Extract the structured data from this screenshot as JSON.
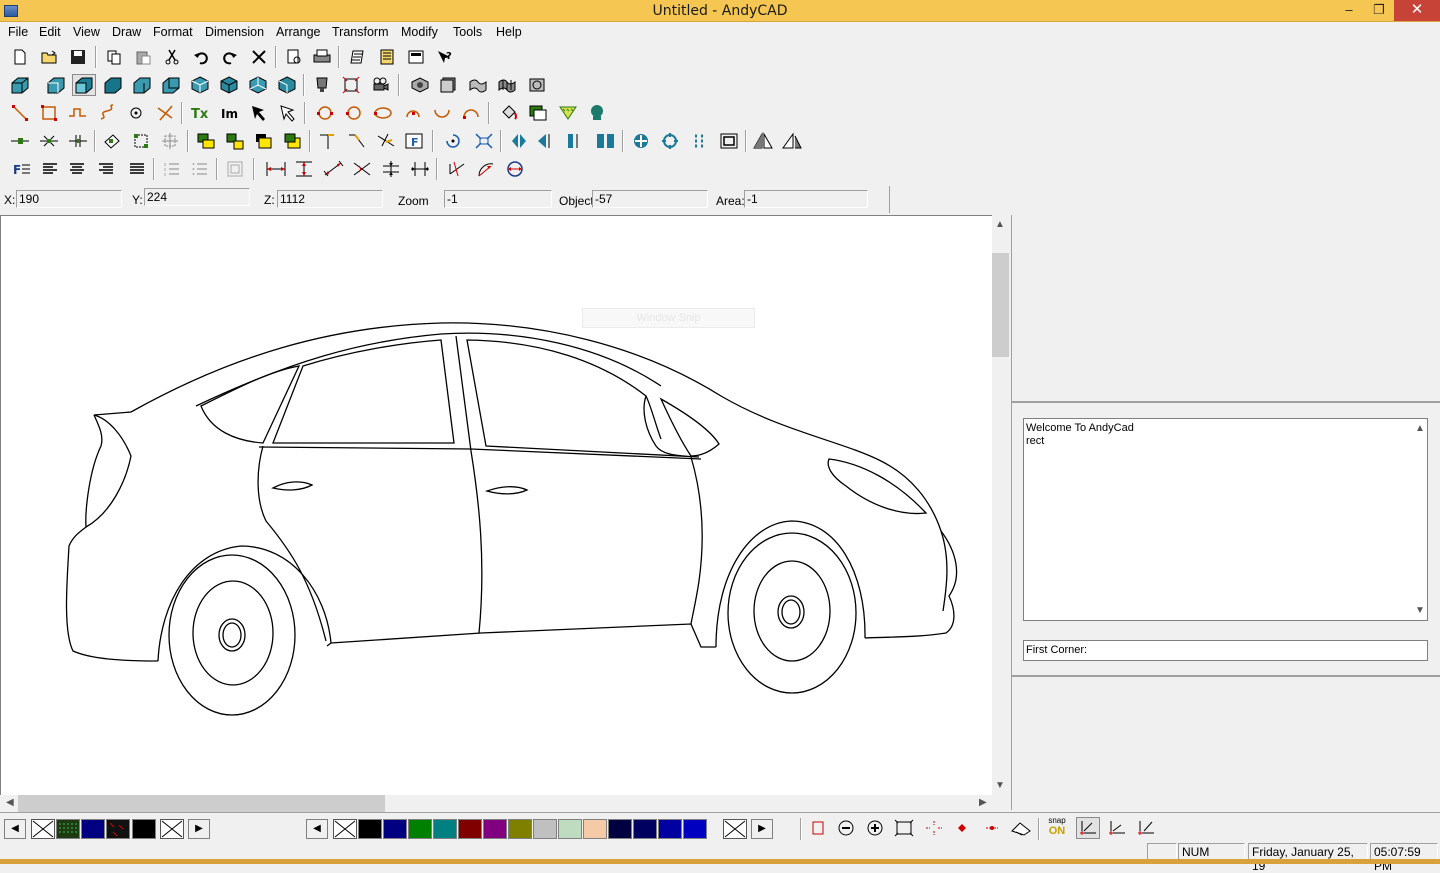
{
  "window": {
    "title": "Untitled - AndyCAD",
    "minimize": "–",
    "restore": "❐",
    "close": "✕"
  },
  "menu": [
    "File",
    "Edit",
    "View",
    "Draw",
    "Format",
    "Dimension",
    "Arrange",
    "Transform",
    "Modify",
    "Tools",
    "Help"
  ],
  "coords": {
    "x_label": "X:",
    "x_value": "190",
    "y_label": "Y:",
    "y_value": "224",
    "z_label": "Z:",
    "z_value": "1112",
    "zoom_label": "Zoom",
    "zoom_value": "-1",
    "object_label": "Object",
    "object_value": "-57",
    "area_label": "Area:",
    "area_value": "-1"
  },
  "canvas": {
    "ghost_text": "Window Snip"
  },
  "command": {
    "log_line1": "Welcome To AndyCad",
    "log_line2": "rect",
    "prompt": "First Corner:"
  },
  "bottom": {
    "snap_label": "snap",
    "snap_state": "ON"
  },
  "palette_left": [
    "#000080",
    "#000000",
    "#000000"
  ],
  "palette_main": [
    "#000000",
    "#000080",
    "#008000",
    "#008080",
    "#800000",
    "#800080",
    "#808000",
    "#c0c0c0",
    "#c0dcc0",
    "#f5cba7",
    "#000040",
    "#000060",
    "#0000a0",
    "#0000c0"
  ],
  "status": {
    "num": "NUM",
    "date": "Friday, January 25, 19",
    "time": "05:07:59 PM"
  }
}
